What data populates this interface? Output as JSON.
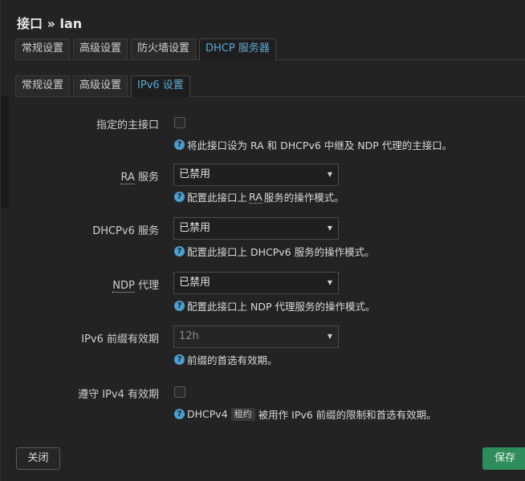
{
  "dialog": {
    "title": "接口 » lan"
  },
  "main_tabs": [
    {
      "label": "常规设置"
    },
    {
      "label": "高级设置"
    },
    {
      "label": "防火墙设置"
    },
    {
      "label": "DHCP 服务器"
    }
  ],
  "sub_tabs": [
    {
      "label": "常规设置"
    },
    {
      "label": "高级设置"
    },
    {
      "label": "IPv6 设置"
    }
  ],
  "fields": {
    "master": {
      "label": "指定的主接口",
      "help": "将此接口设为 RA 和 DHCPv6 中继及 NDP 代理的主接口。",
      "checked": false
    },
    "ra": {
      "label": "RA 服务",
      "label_abbr": "RA",
      "label_rest": " 服务",
      "value": "已禁用",
      "help_pre": "配置此接口上 ",
      "help_abbr": "RA",
      "help_post": " 服务的操作模式。"
    },
    "dhcpv6": {
      "label": "DHCPv6 服务",
      "value": "已禁用",
      "help": "配置此接口上 DHCPv6 服务的操作模式。"
    },
    "ndp": {
      "label": "NDP 代理",
      "label_abbr": "NDP",
      "label_rest": " 代理",
      "value": "已禁用",
      "help": "配置此接口上 NDP 代理服务的操作模式。"
    },
    "prefix_lifetime": {
      "label": "IPv6 前缀有效期",
      "value": "12h",
      "help": "前缀的首选有效期。"
    },
    "ipv4_lifetime": {
      "label": "遵守 IPv4 有效期",
      "help_pre": "DHCPv4",
      "help_code": "租约",
      "help_post": "被用作 IPv6 前缀的限制和首选有效期。",
      "checked": false
    }
  },
  "footer": {
    "close_label": "关闭",
    "save_label": "保存"
  },
  "colors": {
    "accent": "#5aa9d6",
    "save": "#2e8d5a",
    "help_icon": "#4a9fd0"
  }
}
